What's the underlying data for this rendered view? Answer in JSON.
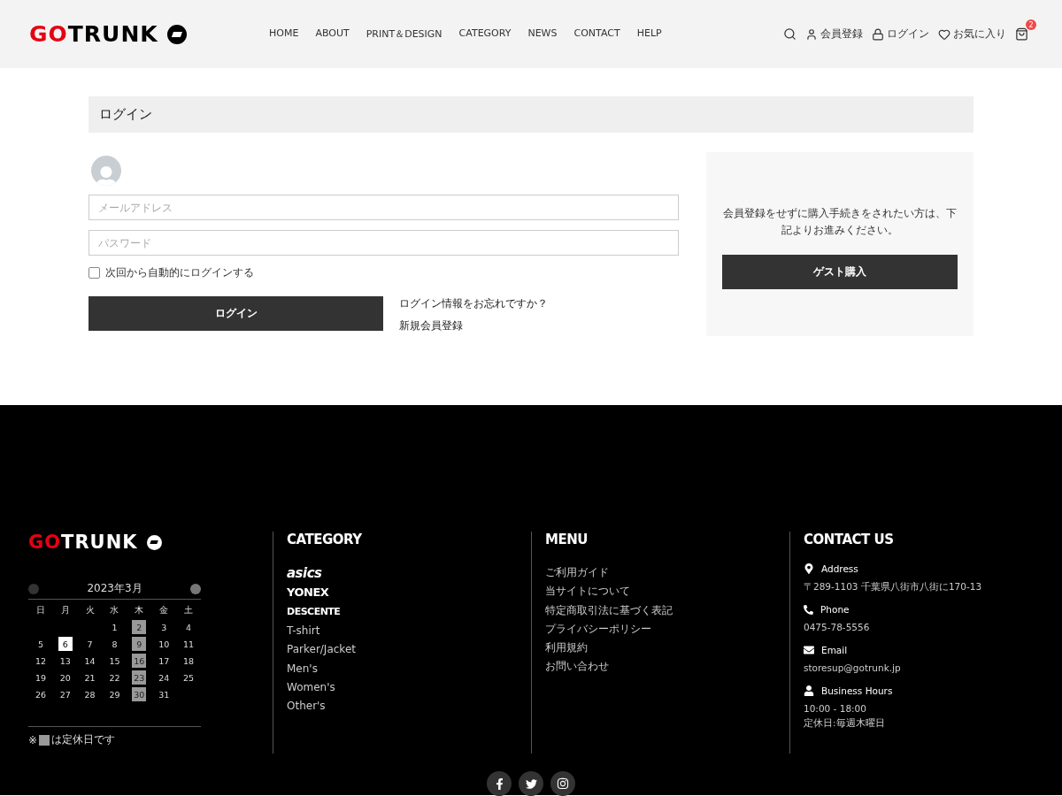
{
  "header": {
    "logo": {
      "accent": "GO",
      "rest": "TRUNK"
    },
    "nav": [
      "HOME",
      "ABOUT",
      "PRINT＆DESIGN",
      "CATEGORY",
      "NEWS",
      "CONTACT",
      "HELP"
    ],
    "actions": [
      {
        "kind": "search"
      },
      {
        "kind": "user",
        "label": "会員登録"
      },
      {
        "kind": "lock",
        "label": "ログイン"
      },
      {
        "kind": "heart",
        "label": "お気に入り"
      },
      {
        "kind": "cart",
        "badge": "2"
      }
    ]
  },
  "login": {
    "title": "ログイン",
    "email": {
      "placeholder": "メールアドレス"
    },
    "password": {
      "placeholder": "パスワード"
    },
    "remember": {
      "label": "次回から自動的にログインする",
      "checked": false
    },
    "submit": "ログイン",
    "links": [
      "ログイン情報をお忘れですか？",
      "新規会員登録"
    ],
    "guest": {
      "text": "会員登録をせずに購入手続きをされたい方は、下記よりお進みください。",
      "button": "ゲスト購入"
    }
  },
  "footer": {
    "logo": {
      "accent": "GO",
      "rest": "TRUNK"
    },
    "calendar": {
      "month": "2023年3月",
      "weekdays": [
        "日",
        "月",
        "火",
        "水",
        "木",
        "金",
        "土"
      ],
      "weeks": [
        {
          "days": [
            {
              "day": "1",
              "holiday": false,
              "today": false
            },
            {
              "day": "2",
              "holiday": true,
              "today": false
            },
            {
              "day": "3",
              "holiday": false,
              "today": false
            },
            {
              "day": "4",
              "holiday": false,
              "today": false
            }
          ]
        },
        {
          "days": [
            {
              "day": "5",
              "holiday": false,
              "today": false
            },
            {
              "day": "6",
              "holiday": false,
              "today": true
            },
            {
              "day": "7",
              "holiday": false,
              "today": false
            },
            {
              "day": "8",
              "holiday": false,
              "today": false
            },
            {
              "day": "9",
              "holiday": true,
              "today": false
            },
            {
              "day": "10",
              "holiday": false,
              "today": false
            },
            {
              "day": "11",
              "holiday": false,
              "today": false
            }
          ]
        },
        {
          "days": [
            {
              "day": "12",
              "holiday": false,
              "today": false
            },
            {
              "day": "13",
              "holiday": false,
              "today": false
            },
            {
              "day": "14",
              "holiday": false,
              "today": false
            },
            {
              "day": "15",
              "holiday": false,
              "today": false
            },
            {
              "day": "16",
              "holiday": true,
              "today": false
            },
            {
              "day": "17",
              "holiday": false,
              "today": false
            },
            {
              "day": "18",
              "holiday": false,
              "today": false
            }
          ]
        },
        {
          "days": [
            {
              "day": "19",
              "holiday": false,
              "today": false
            },
            {
              "day": "20",
              "holiday": false,
              "today": false
            },
            {
              "day": "21",
              "holiday": false,
              "today": false
            },
            {
              "day": "22",
              "holiday": false,
              "today": false
            },
            {
              "day": "23",
              "holiday": true,
              "today": false
            },
            {
              "day": "24",
              "holiday": false,
              "today": false
            },
            {
              "day": "25",
              "holiday": false,
              "today": false
            }
          ]
        },
        {
          "days": [
            {
              "day": "26",
              "holiday": false,
              "today": false
            },
            {
              "day": "27",
              "holiday": false,
              "today": false
            },
            {
              "day": "28",
              "holiday": false,
              "today": false
            },
            {
              "day": "29",
              "holiday": false,
              "today": false
            },
            {
              "day": "30",
              "holiday": true,
              "today": false
            },
            {
              "day": "31",
              "holiday": false,
              "today": false
            }
          ]
        }
      ],
      "legend": {
        "mark": "※",
        "text": "は定休日です"
      }
    },
    "category": {
      "title": "CATEGORY",
      "brands": [
        {
          "kind": "asics",
          "label": "asics"
        },
        {
          "kind": "yonex",
          "label": "YONEX"
        },
        {
          "kind": "descente",
          "label": "DESCENTE"
        }
      ],
      "items": [
        "T-shirt",
        "Parker/Jacket",
        "Men's",
        "Women's",
        "Other's"
      ]
    },
    "menu": {
      "title": "MENU",
      "items": [
        "ご利用ガイド",
        "当サイトについて",
        "特定商取引法に基づく表記",
        "プライバシーポリシー",
        "利用規約",
        "お問い合わせ"
      ]
    },
    "contact": {
      "title": "CONTACT US",
      "items": [
        {
          "kind": "address",
          "label": "Address",
          "lines": [
            "〒289-1103 千葉県八街市八街に170-13"
          ]
        },
        {
          "kind": "phone",
          "label": "Phone",
          "lines": [
            "0475-78-5556"
          ]
        },
        {
          "kind": "email",
          "label": "Email",
          "lines": [
            "storesup@gotrunk.jp"
          ]
        },
        {
          "kind": "hours",
          "label": "Business Hours",
          "lines": [
            "10:00 - 18:00",
            "定休日:毎週木曜日"
          ]
        }
      ]
    },
    "social": [
      {
        "kind": "facebook"
      },
      {
        "kind": "twitter"
      },
      {
        "kind": "instagram"
      }
    ]
  }
}
